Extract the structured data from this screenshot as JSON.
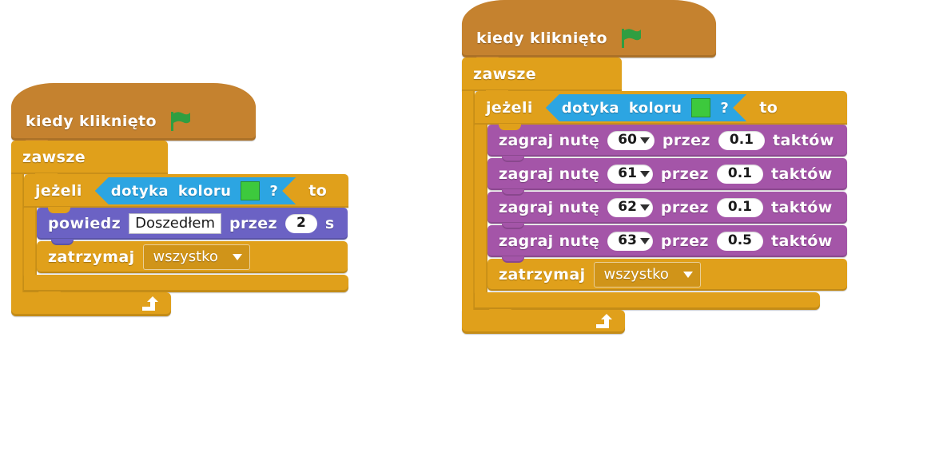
{
  "colors": {
    "events_hat": "#c5822f",
    "control": "#e0a01b",
    "sensing": "#2ca5e2",
    "looks": "#6b62c4",
    "sound": "#a455a8",
    "flag_green": "#2f9e41",
    "swatch_green": "#3dc93d",
    "background": "#ffffff"
  },
  "scripts": [
    {
      "id": "script-left",
      "hat": {
        "label": "kiedy  kliknięto",
        "icon": "green-flag-icon"
      },
      "forever": {
        "label": "zawsze"
      },
      "if": {
        "label": "jeżeli",
        "then_label": "to",
        "condition": {
          "label_a": "dotyka",
          "label_b": "koloru",
          "swatch": "#3dc93d",
          "question": "?"
        }
      },
      "body": [
        {
          "type": "say-for-secs",
          "category": "looks",
          "label_a": "powiedz",
          "message": "Doszedłem",
          "label_b": "przez",
          "seconds": "2",
          "label_c": "s"
        },
        {
          "type": "stop",
          "category": "control",
          "label_a": "zatrzymaj",
          "option": "wszystko"
        }
      ]
    },
    {
      "id": "script-right",
      "hat": {
        "label": "kiedy  kliknięto",
        "icon": "green-flag-icon"
      },
      "forever": {
        "label": "zawsze"
      },
      "if": {
        "label": "jeżeli",
        "then_label": "to",
        "condition": {
          "label_a": "dotyka",
          "label_b": "koloru",
          "swatch": "#3dc93d",
          "question": "?"
        }
      },
      "body": [
        {
          "type": "play-note",
          "category": "sound",
          "label_a": "zagraj  nutę",
          "note": "60",
          "label_b": "przez",
          "beats": "0.1",
          "label_c": "taktów"
        },
        {
          "type": "play-note",
          "category": "sound",
          "label_a": "zagraj  nutę",
          "note": "61",
          "label_b": "przez",
          "beats": "0.1",
          "label_c": "taktów"
        },
        {
          "type": "play-note",
          "category": "sound",
          "label_a": "zagraj  nutę",
          "note": "62",
          "label_b": "przez",
          "beats": "0.1",
          "label_c": "taktów"
        },
        {
          "type": "play-note",
          "category": "sound",
          "label_a": "zagraj  nutę",
          "note": "63",
          "label_b": "przez",
          "beats": "0.5",
          "label_c": "taktów"
        },
        {
          "type": "stop",
          "category": "control",
          "label_a": "zatrzymaj",
          "option": "wszystko"
        }
      ]
    }
  ]
}
